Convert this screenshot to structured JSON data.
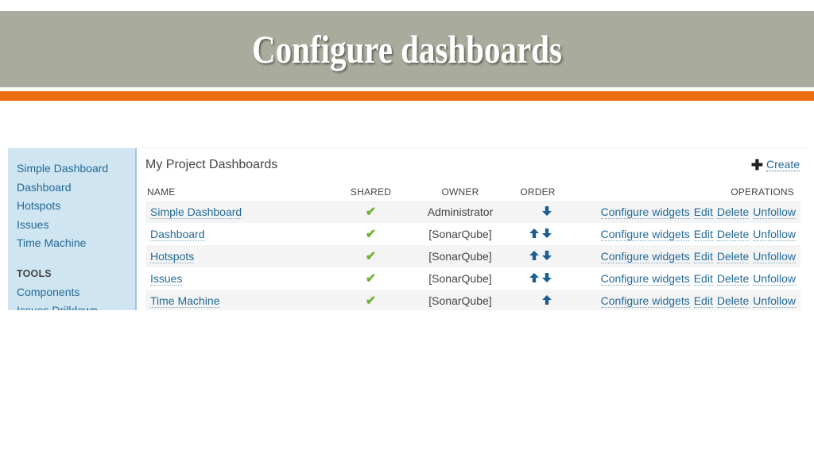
{
  "slide": {
    "title": "Configure dashboards"
  },
  "sidebar": {
    "items": [
      {
        "label": "Simple Dashboard"
      },
      {
        "label": "Dashboard"
      },
      {
        "label": "Hotspots"
      },
      {
        "label": "Issues"
      },
      {
        "label": "Time Machine"
      }
    ],
    "tools_heading": "TOOLS",
    "tools": [
      {
        "label": "Components"
      },
      {
        "label": "Issues Drilldown"
      }
    ]
  },
  "panel": {
    "title": "My Project Dashboards",
    "create_label": "Create"
  },
  "table": {
    "headers": {
      "name": "NAME",
      "shared": "SHARED",
      "owner": "OWNER",
      "order": "ORDER",
      "operations": "OPERATIONS"
    },
    "rows": [
      {
        "name": "Simple Dashboard",
        "shared": true,
        "owner": "Administrator",
        "order_up": false,
        "order_down": true
      },
      {
        "name": "Dashboard",
        "shared": true,
        "owner": "[SonarQube]",
        "order_up": true,
        "order_down": true
      },
      {
        "name": "Hotspots",
        "shared": true,
        "owner": "[SonarQube]",
        "order_up": true,
        "order_down": true
      },
      {
        "name": "Issues",
        "shared": true,
        "owner": "[SonarQube]",
        "order_up": true,
        "order_down": true
      },
      {
        "name": "Time Machine",
        "shared": true,
        "owner": "[SonarQube]",
        "order_up": true,
        "order_down": false
      }
    ],
    "operations": {
      "configure": "Configure widgets",
      "edit": "Edit",
      "delete": "Delete",
      "unfollow": "Unfollow"
    }
  },
  "colors": {
    "title_band": "#a9ac9c",
    "accent_rule": "#ec6c12",
    "link": "#236a97",
    "check": "#6fb234",
    "sidebar_bg": "#cfe5f1"
  }
}
